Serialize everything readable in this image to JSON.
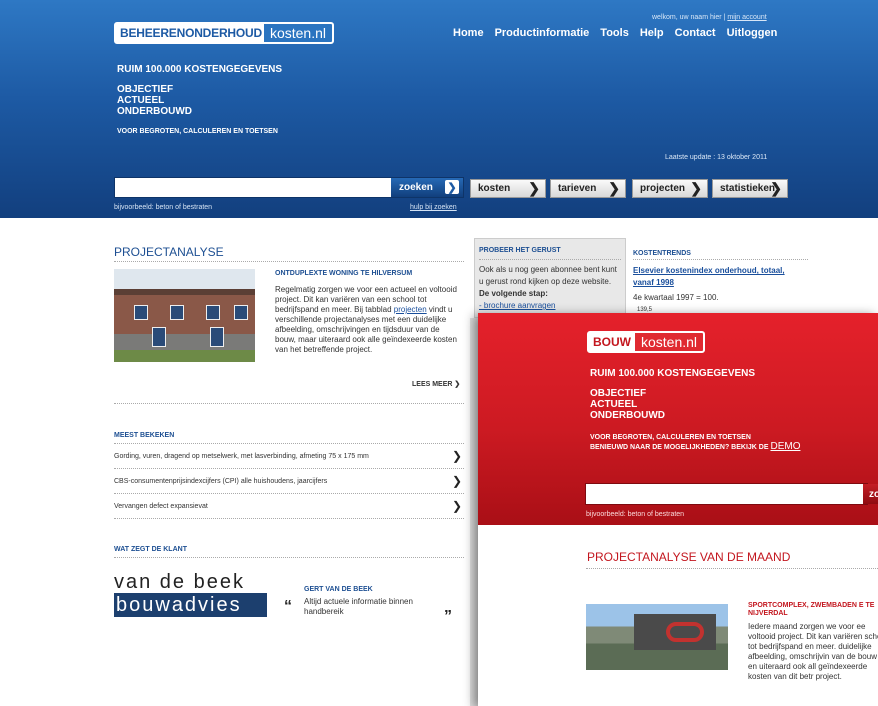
{
  "blue": {
    "logo": {
      "part1": "BEHEERENONDERHOUD",
      "part2": "kosten.nl"
    },
    "welcome_text": "welkom, uw naam hier |",
    "account_link": "mijn account",
    "nav": [
      "Home",
      "Productinformatie",
      "Tools",
      "Help",
      "Contact",
      "Uitloggen"
    ],
    "tagline1": "RUIM 100.000 KOSTENGEGEVENS",
    "tagline2": [
      "OBJECTIEF",
      "ACTUEEL",
      "ONDERBOUWD"
    ],
    "tagline3": "VOOR BEGROTEN, CALCULEREN EN TOETSEN",
    "last_update": "Laatste update : 13 oktober 2011",
    "search": {
      "value": "",
      "button": "zoeken",
      "example": "bijvoorbeeld: beton of bestraten",
      "help": "hulp bij zoeken"
    },
    "tabs": [
      "kosten",
      "tarieven",
      "projecten",
      "statistieken"
    ],
    "project": {
      "heading": "PROJECTANALYSE",
      "subtitle": "ONTDUPLEXTE WONING TE HILVERSUM",
      "text_before": "Regelmatig zorgen we voor een actueel en voltooid project. Dit kan variëren van een school tot bedrijfspand en meer. Bij tabblad",
      "link": "projecten",
      "text_after": "vindt u verschillende projectanalyses met een duidelijke afbeelding, omschrijvingen en tijdsduur van de bouw, maar uiteraard ook alle geïndexeerde kosten van het betreffende project.",
      "more": "LEES MEER"
    },
    "most_viewed": {
      "heading": "MEEST BEKEKEN",
      "items": [
        "Gording, vuren, dragend op metselwerk, met lasverbinding, afmeting 75 x 175 mm",
        "CBS-consumentenprijsindexcijfers (CPI) alle huishoudens, jaarcijfers",
        "Vervangen defect expansievat"
      ]
    },
    "client": {
      "heading": "WAT ZEGT DE KLANT",
      "logo_line1": "van de beek",
      "logo_line2": "bouwadvies",
      "name": "GERT VAN DE BEEK",
      "quote": "Altijd actuele informatie binnen handbereik",
      "open_quote": "“",
      "close_quote": "”"
    },
    "try": {
      "heading": "PROBEER HET GERUST",
      "text": "Ook als u nog geen abonnee bent kunt u gerust rond kijken op deze website.",
      "bold": "De volgende stap:",
      "link": "- brochure aanvragen"
    },
    "trends": {
      "heading": "KOSTENTRENDS",
      "link": "Elsevier kostenindex onderhoud, totaal, vanaf 1998",
      "sub": "4e kwartaal 1997 = 100.",
      "value": "139,5"
    }
  },
  "red": {
    "logo": {
      "part1": "BOUW",
      "part2": "kosten.nl"
    },
    "tagline1": "RUIM 100.000 KOSTENGEGEVENS",
    "tagline2": [
      "OBJECTIEF",
      "ACTUEEL",
      "ONDERBOUWD"
    ],
    "tagline3": "VOOR BEGROTEN, CALCULEREN EN TOETSEN",
    "tagline4": "BENIEUWD NAAR DE MOGELIJKHEDEN? BEKIJK DE",
    "demo": "DEMO",
    "search": {
      "value": "",
      "button": "zo",
      "example": "bijvoorbeeld: beton of bestraten"
    },
    "heading": "PROJECTANALYSE VAN DE MAAND",
    "subtitle": "SPORTCOMPLEX, ZWEMBADEN E TE NIJVERDAL",
    "text": "Iedere maand zorgen we voor ee voltooid project. Dit kan variëren school tot bedrijfspand en meer. duidelijke afbeelding, omschrijvin van de bouw en uiteraard ook all geïndexeerde kosten van dit betr project."
  },
  "colors": {
    "blue_accent": "#1d4f92",
    "red_accent": "#c3161e"
  }
}
